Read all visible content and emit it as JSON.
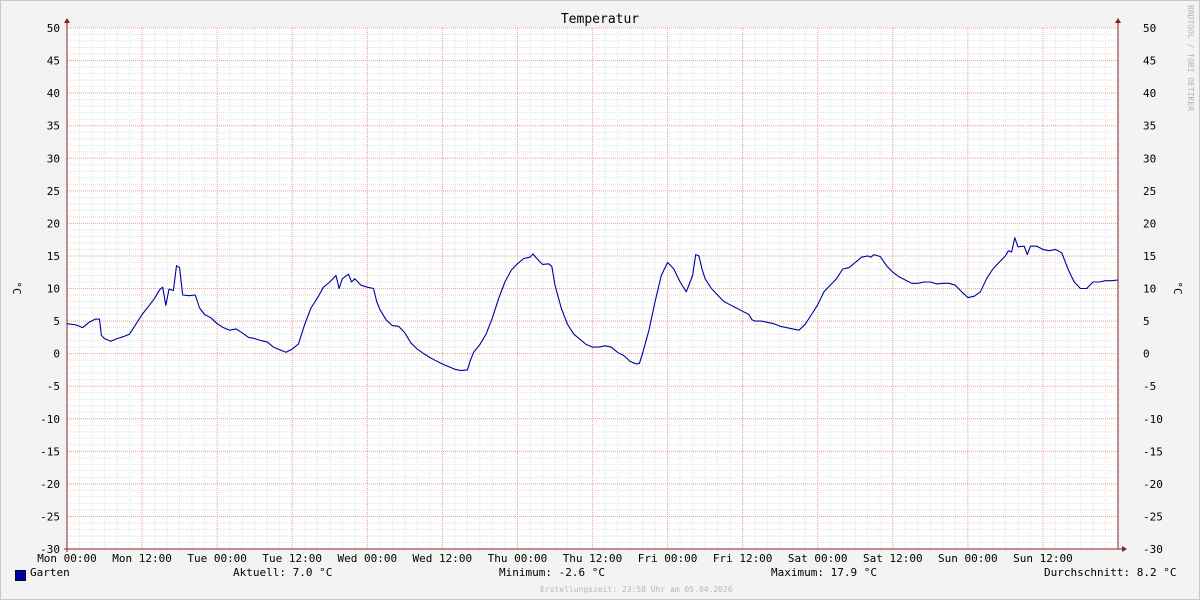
{
  "chart_data": {
    "type": "line",
    "title": "Temperatur",
    "ylabel_left": "°C",
    "ylabel_right": "°C",
    "ylim": [
      -30,
      50
    ],
    "y_ticks": [
      "50",
      "45",
      "40",
      "35",
      "30",
      "25",
      "20",
      "15",
      "10",
      "5",
      "0",
      "-5",
      "-10",
      "-15",
      "-20",
      "-25",
      "-30"
    ],
    "x_ticks": [
      "Mon 00:00",
      "Mon 12:00",
      "Tue 00:00",
      "Tue 12:00",
      "Wed 00:00",
      "Wed 12:00",
      "Thu 00:00",
      "Thu 12:00",
      "Fri 00:00",
      "Fri 12:00",
      "Sat 00:00",
      "Sat 12:00",
      "Sun 00:00",
      "Sun 12:00"
    ],
    "x_unit": "hours since Mon 00:00",
    "xlim": [
      0,
      168
    ],
    "grid": true,
    "series": [
      {
        "name": "Garten",
        "color": "#0000a0",
        "points": [
          [
            0,
            4.6
          ],
          [
            1.5,
            4.4
          ],
          [
            2.5,
            4.0
          ],
          [
            3.5,
            4.8
          ],
          [
            4.5,
            5.3
          ],
          [
            5.2,
            5.3
          ],
          [
            5.5,
            2.8
          ],
          [
            6,
            2.3
          ],
          [
            7,
            1.9
          ],
          [
            8,
            2.3
          ],
          [
            9,
            2.6
          ],
          [
            10,
            3.0
          ],
          [
            11,
            4.5
          ],
          [
            12,
            6.0
          ],
          [
            13,
            7.2
          ],
          [
            14,
            8.5
          ],
          [
            14.8,
            9.8
          ],
          [
            15.3,
            10.2
          ],
          [
            15.8,
            7.4
          ],
          [
            16.3,
            9.9
          ],
          [
            17,
            9.7
          ],
          [
            17.5,
            13.5
          ],
          [
            18,
            13.2
          ],
          [
            18.5,
            9.0
          ],
          [
            19.5,
            8.9
          ],
          [
            20.5,
            9.0
          ],
          [
            21.2,
            7.0
          ],
          [
            22,
            6.0
          ],
          [
            23,
            5.5
          ],
          [
            24,
            4.6
          ],
          [
            25,
            4.0
          ],
          [
            26,
            3.6
          ],
          [
            27,
            3.8
          ],
          [
            28,
            3.2
          ],
          [
            29,
            2.5
          ],
          [
            30,
            2.3
          ],
          [
            31,
            2.0
          ],
          [
            32,
            1.8
          ],
          [
            33,
            1.0
          ],
          [
            34,
            0.6
          ],
          [
            35,
            0.2
          ],
          [
            36,
            0.7
          ],
          [
            37,
            1.5
          ],
          [
            38,
            4.5
          ],
          [
            39,
            7.0
          ],
          [
            40,
            8.5
          ],
          [
            41,
            10.2
          ],
          [
            42,
            11.0
          ],
          [
            43,
            12.0
          ],
          [
            43.5,
            10.0
          ],
          [
            44,
            11.5
          ],
          [
            45,
            12.2
          ],
          [
            45.5,
            11.0
          ],
          [
            46,
            11.5
          ],
          [
            47,
            10.5
          ],
          [
            48,
            10.2
          ],
          [
            49,
            10.0
          ],
          [
            49.5,
            8.0
          ],
          [
            50,
            6.8
          ],
          [
            51,
            5.2
          ],
          [
            52,
            4.3
          ],
          [
            53,
            4.2
          ],
          [
            54,
            3.2
          ],
          [
            55,
            1.6
          ],
          [
            56,
            0.7
          ],
          [
            57,
            0.0
          ],
          [
            58,
            -0.6
          ],
          [
            59,
            -1.1
          ],
          [
            60,
            -1.6
          ],
          [
            61,
            -2.0
          ],
          [
            62,
            -2.4
          ],
          [
            63,
            -2.6
          ],
          [
            64,
            -2.5
          ],
          [
            64.5,
            -1.0
          ],
          [
            65,
            0.2
          ],
          [
            66,
            1.4
          ],
          [
            67,
            3.0
          ],
          [
            68,
            5.5
          ],
          [
            69,
            8.5
          ],
          [
            70,
            11.0
          ],
          [
            71,
            12.8
          ],
          [
            72,
            13.8
          ],
          [
            73,
            14.6
          ],
          [
            74,
            14.8
          ],
          [
            74.5,
            15.3
          ],
          [
            75,
            14.7
          ],
          [
            76,
            13.7
          ],
          [
            77,
            13.8
          ],
          [
            77.5,
            13.4
          ],
          [
            78,
            10.5
          ],
          [
            79,
            7.0
          ],
          [
            80,
            4.5
          ],
          [
            81,
            3.0
          ],
          [
            82,
            2.2
          ],
          [
            83,
            1.4
          ],
          [
            84,
            1.0
          ],
          [
            85,
            1.0
          ],
          [
            86,
            1.2
          ],
          [
            87,
            1.0
          ],
          [
            88,
            0.2
          ],
          [
            89,
            -0.3
          ],
          [
            90,
            -1.2
          ],
          [
            91,
            -1.6
          ],
          [
            91.5,
            -1.5
          ],
          [
            92,
            0.0
          ],
          [
            93,
            3.5
          ],
          [
            94,
            8.0
          ],
          [
            95,
            12.0
          ],
          [
            96,
            14.0
          ],
          [
            97,
            13.0
          ],
          [
            98,
            11.0
          ],
          [
            99,
            9.5
          ],
          [
            100,
            12.0
          ],
          [
            100.5,
            15.2
          ],
          [
            101,
            15.0
          ],
          [
            101.5,
            13.0
          ],
          [
            102,
            11.5
          ],
          [
            103,
            10.0
          ],
          [
            104,
            9.0
          ],
          [
            105,
            8.0
          ],
          [
            106,
            7.5
          ],
          [
            107,
            7.0
          ],
          [
            108,
            6.5
          ],
          [
            109,
            6.0
          ],
          [
            109.5,
            5.2
          ],
          [
            110,
            5.0
          ],
          [
            111,
            5.0
          ],
          [
            112,
            4.8
          ],
          [
            113,
            4.6
          ],
          [
            114,
            4.2
          ],
          [
            115,
            4.0
          ],
          [
            116,
            3.8
          ],
          [
            117,
            3.6
          ],
          [
            118,
            4.5
          ],
          [
            119,
            6.0
          ],
          [
            120,
            7.5
          ],
          [
            121,
            9.5
          ],
          [
            122,
            10.5
          ],
          [
            123,
            11.5
          ],
          [
            124,
            13.0
          ],
          [
            125,
            13.2
          ],
          [
            126,
            14.0
          ],
          [
            127,
            14.8
          ],
          [
            128,
            15.0
          ],
          [
            128.5,
            14.8
          ],
          [
            129,
            15.2
          ],
          [
            130,
            14.9
          ],
          [
            130.5,
            14.2
          ],
          [
            131,
            13.5
          ],
          [
            132,
            12.5
          ],
          [
            133,
            11.8
          ],
          [
            134,
            11.3
          ],
          [
            135,
            10.8
          ],
          [
            136,
            10.8
          ],
          [
            137,
            11.0
          ],
          [
            138,
            11.0
          ],
          [
            139,
            10.7
          ],
          [
            140,
            10.8
          ],
          [
            141,
            10.8
          ],
          [
            142,
            10.5
          ],
          [
            143,
            9.5
          ],
          [
            144,
            8.6
          ],
          [
            145,
            8.8
          ],
          [
            146,
            9.5
          ],
          [
            147,
            11.5
          ],
          [
            148,
            13.0
          ],
          [
            149,
            14.0
          ],
          [
            150,
            15.0
          ],
          [
            150.5,
            15.8
          ],
          [
            151,
            15.6
          ],
          [
            151.5,
            17.8
          ],
          [
            152,
            16.4
          ],
          [
            153,
            16.5
          ],
          [
            153.5,
            15.2
          ],
          [
            154,
            16.5
          ],
          [
            155,
            16.5
          ],
          [
            156,
            16.0
          ],
          [
            157,
            15.8
          ],
          [
            158,
            16.0
          ],
          [
            159,
            15.5
          ],
          [
            160,
            13.0
          ],
          [
            161,
            11.0
          ],
          [
            162,
            10.0
          ],
          [
            163,
            10.0
          ],
          [
            164,
            11.0
          ],
          [
            165,
            11.0
          ],
          [
            166,
            11.2
          ],
          [
            167,
            11.2
          ],
          [
            168,
            11.3
          ]
        ]
      }
    ]
  },
  "legend": {
    "label": "Garten",
    "color": "#0000a0"
  },
  "footer": {
    "aktuell": "Aktuell: 7.0 °C",
    "minimum": "Minimum: -2.6 °C",
    "maximum": "Maximum: 17.9 °C",
    "durchschnitt": "Durchschnitt: 8.2 °C"
  },
  "credit": "Erstellungszeit: 23:58 Uhr am 05.04.2026",
  "watermark": "RRDTOOL / TOBI OETIKER"
}
